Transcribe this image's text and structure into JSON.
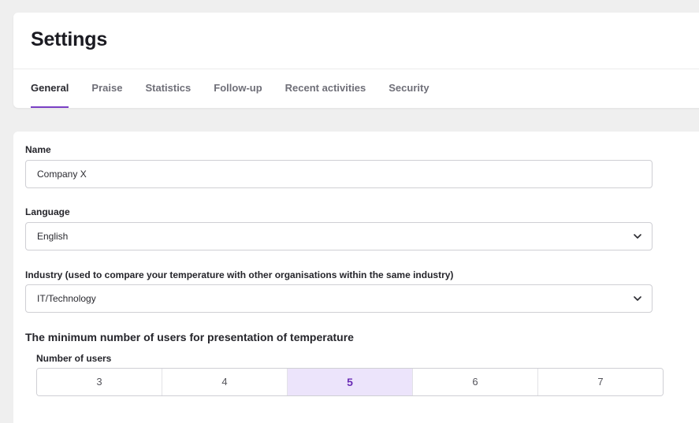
{
  "header": {
    "title": "Settings",
    "tabs": [
      {
        "label": "General",
        "active": true
      },
      {
        "label": "Praise",
        "active": false
      },
      {
        "label": "Statistics",
        "active": false
      },
      {
        "label": "Follow-up",
        "active": false
      },
      {
        "label": "Recent activities",
        "active": false
      },
      {
        "label": "Security",
        "active": false
      }
    ]
  },
  "form": {
    "name": {
      "label": "Name",
      "value": "Company X"
    },
    "language": {
      "label": "Language",
      "value": "English",
      "icon": "chevron-down-icon"
    },
    "industry": {
      "label": "Industry (used to compare your temperature with other organisations within the same industry)",
      "value": "IT/Technology",
      "icon": "chevron-down-icon"
    },
    "min_users": {
      "title": "The minimum number of users for presentation of temperature",
      "sub_label": "Number of users",
      "options": [
        "3",
        "4",
        "5",
        "6",
        "7"
      ],
      "selected": "5"
    }
  },
  "colors": {
    "accent": "#7a3fc4",
    "selected_bg": "#ece4fb",
    "selected_text": "#6a2db5",
    "page_bg": "#efefef"
  }
}
